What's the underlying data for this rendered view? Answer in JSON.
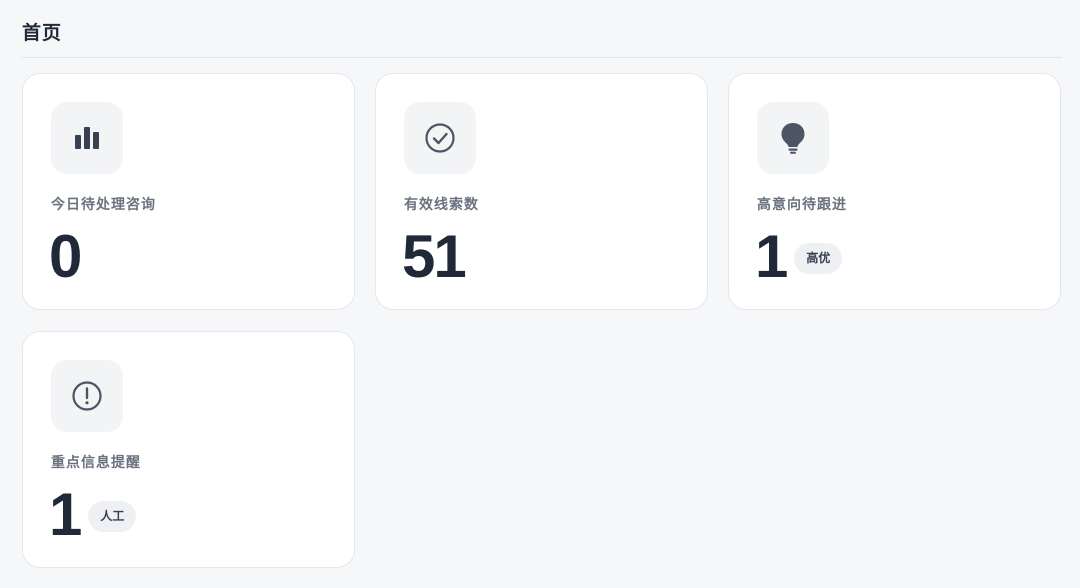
{
  "header": {
    "title": "首页"
  },
  "cards": [
    {
      "icon": "bar-chart-icon",
      "label": "今日待处理咨询",
      "value": "0",
      "badge": ""
    },
    {
      "icon": "check-circle-icon",
      "label": "有效线索数",
      "value": "51",
      "badge": ""
    },
    {
      "icon": "lightbulb-icon",
      "label": "高意向待跟进",
      "value": "1",
      "badge": "高优"
    },
    {
      "icon": "alert-circle-icon",
      "label": "重点信息提醒",
      "value": "1",
      "badge": "人工"
    }
  ],
  "colors": {
    "background": "#f6f7f9",
    "card": "#ffffff",
    "icon": "#374151",
    "label": "#6b7280",
    "badge_bg": "#eef0f3"
  }
}
